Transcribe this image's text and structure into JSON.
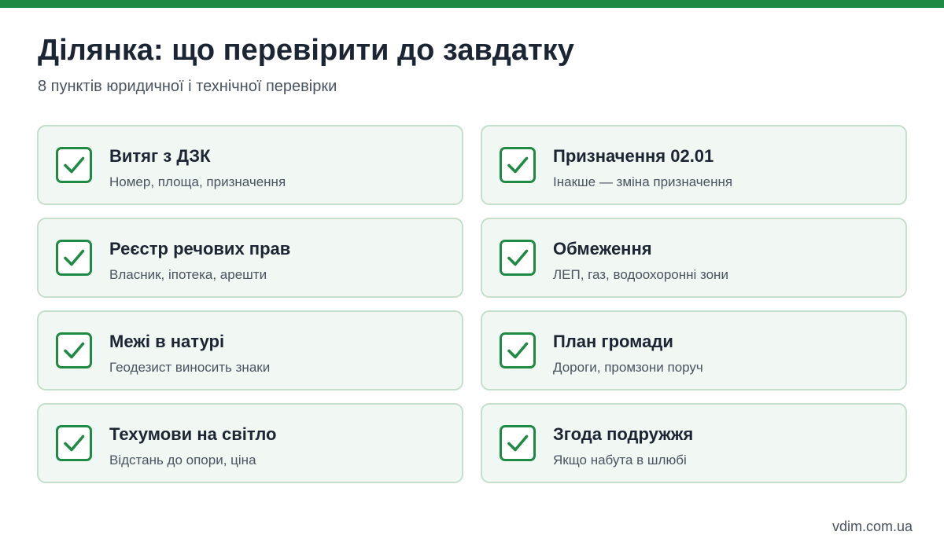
{
  "colors": {
    "accent": "#1e8a44",
    "card_bg": "#f1f7f2",
    "card_border": "#c5dfcc",
    "title_text": "#1c2533",
    "body_text": "#4a5361"
  },
  "header": {
    "title": "Ділянка: що перевірити до завдатку",
    "subtitle": "8 пунктів юридичної і технічної перевірки"
  },
  "items": [
    {
      "title": "Витяг з ДЗК",
      "desc": "Номер, площа, призначення",
      "icon": "checkbox-checked-icon"
    },
    {
      "title": "Призначення 02.01",
      "desc": "Інакше — зміна призначення",
      "icon": "checkbox-checked-icon"
    },
    {
      "title": "Реєстр речових прав",
      "desc": "Власник, іпотека, арешти",
      "icon": "checkbox-checked-icon"
    },
    {
      "title": "Обмеження",
      "desc": "ЛЕП, газ, водоохоронні зони",
      "icon": "checkbox-checked-icon"
    },
    {
      "title": "Межі в натурі",
      "desc": "Геодезист виносить знаки",
      "icon": "checkbox-checked-icon"
    },
    {
      "title": "План громади",
      "desc": "Дороги, промзони поруч",
      "icon": "checkbox-checked-icon"
    },
    {
      "title": "Техумови на світло",
      "desc": "Відстань до опори, ціна",
      "icon": "checkbox-checked-icon"
    },
    {
      "title": "Згода подружжя",
      "desc": "Якщо набута в шлюбі",
      "icon": "checkbox-checked-icon"
    }
  ],
  "footer": {
    "site": "vdim.com.ua"
  }
}
